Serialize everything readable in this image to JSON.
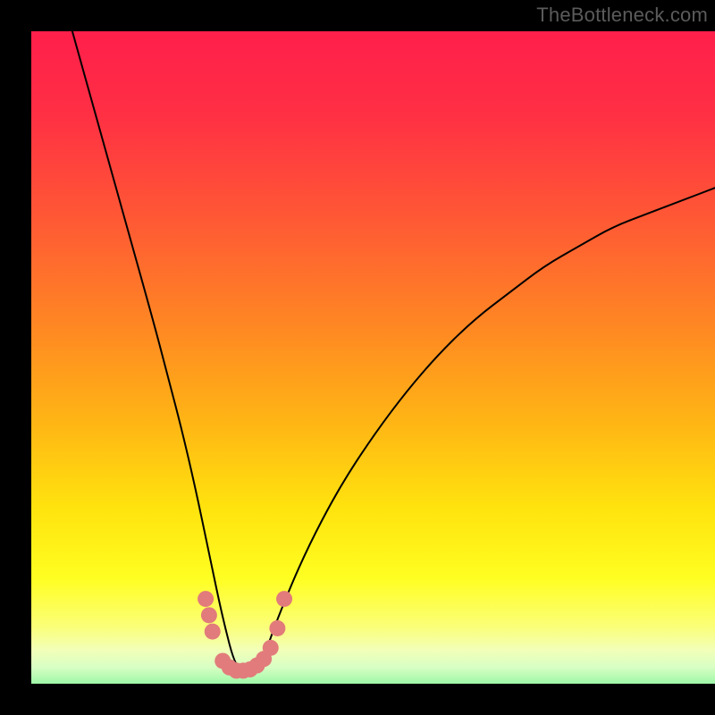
{
  "watermark": "TheBottleneck.com",
  "chart_data": {
    "type": "line",
    "title": "",
    "xlabel": "",
    "ylabel": "",
    "xlim": [
      0,
      100
    ],
    "ylim": [
      0,
      100
    ],
    "grid": false,
    "legend": false,
    "minimum_x": 30,
    "series": [
      {
        "name": "bottleneck-curve",
        "x": [
          6,
          10,
          14,
          18,
          20,
          22,
          24,
          26,
          28,
          30,
          32,
          34,
          36,
          40,
          45,
          50,
          55,
          60,
          65,
          70,
          75,
          80,
          85,
          90,
          95,
          100
        ],
        "y": [
          100,
          85,
          70,
          55,
          47,
          39,
          30,
          20,
          10,
          2,
          2,
          4,
          10,
          20,
          30,
          38,
          45,
          51,
          56,
          60,
          64,
          67,
          70,
          72,
          74,
          76
        ]
      }
    ],
    "boundary_dots": {
      "name": "threshold-markers",
      "color": "#e27b7b",
      "points": [
        {
          "x": 25.5,
          "y": 13
        },
        {
          "x": 26.0,
          "y": 10.5
        },
        {
          "x": 26.5,
          "y": 8
        },
        {
          "x": 28.0,
          "y": 3.5
        },
        {
          "x": 29.0,
          "y": 2.5
        },
        {
          "x": 30.0,
          "y": 2
        },
        {
          "x": 31.0,
          "y": 2
        },
        {
          "x": 32.0,
          "y": 2.2
        },
        {
          "x": 33.0,
          "y": 2.8
        },
        {
          "x": 34.0,
          "y": 3.8
        },
        {
          "x": 35.0,
          "y": 5.5
        },
        {
          "x": 36.0,
          "y": 8.5
        },
        {
          "x": 37.0,
          "y": 13
        }
      ]
    },
    "background_gradient": {
      "stops": [
        {
          "offset": 0.0,
          "color": "#ff1f4b"
        },
        {
          "offset": 0.12,
          "color": "#ff2f44"
        },
        {
          "offset": 0.28,
          "color": "#ff5a34"
        },
        {
          "offset": 0.44,
          "color": "#ff8a22"
        },
        {
          "offset": 0.58,
          "color": "#ffb814"
        },
        {
          "offset": 0.7,
          "color": "#ffe40e"
        },
        {
          "offset": 0.8,
          "color": "#fffe22"
        },
        {
          "offset": 0.87,
          "color": "#fbff77"
        },
        {
          "offset": 0.905,
          "color": "#f2ffb8"
        },
        {
          "offset": 0.93,
          "color": "#d8ffc4"
        },
        {
          "offset": 0.955,
          "color": "#9cf7a7"
        },
        {
          "offset": 0.975,
          "color": "#4be789"
        },
        {
          "offset": 1.0,
          "color": "#17d874"
        }
      ]
    }
  }
}
